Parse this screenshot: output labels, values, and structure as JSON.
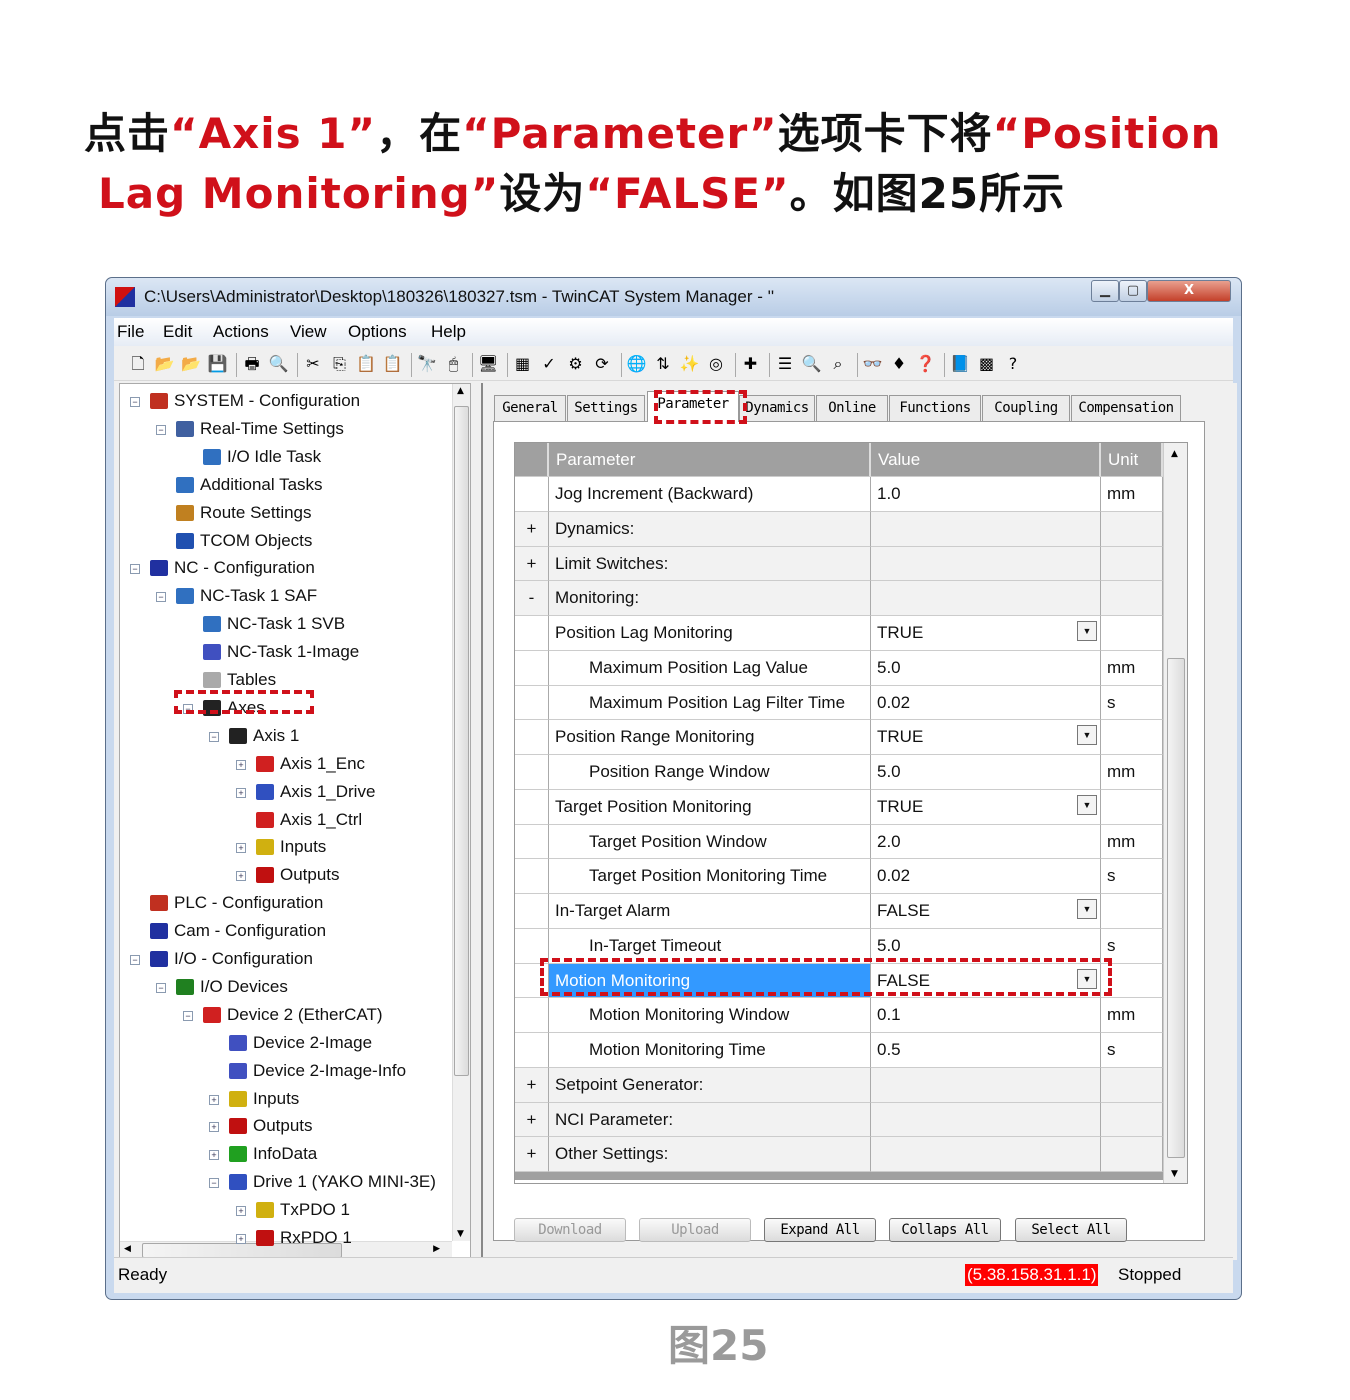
{
  "instruction": {
    "line1": [
      {
        "t": "点击",
        "q": false
      },
      {
        "t": "“Axis 1”",
        "q": true
      },
      {
        "t": "，在",
        "q": false
      },
      {
        "t": "“Parameter”",
        "q": true
      },
      {
        "t": "选项卡下将",
        "q": false
      },
      {
        "t": "“Position",
        "q": true
      }
    ],
    "line2": [
      {
        "t": "Lag Monitoring”",
        "q": true
      },
      {
        "t": "设为",
        "q": false
      },
      {
        "t": "“FALSE”",
        "q": true
      },
      {
        "t": "。如图25所示",
        "q": false
      }
    ]
  },
  "window": {
    "title": "C:\\Users\\Administrator\\Desktop\\180326\\180327.tsm - TwinCAT System Manager - ''",
    "minimize": "▁",
    "maximize": "▢",
    "close": "X"
  },
  "menu": [
    "File",
    "Edit",
    "Actions",
    "View",
    "Options",
    "Help"
  ],
  "toolbar": [
    {
      "icon": "new-file-icon",
      "g": "🗋"
    },
    {
      "icon": "open-folder-icon",
      "g": "📂"
    },
    {
      "icon": "open-icon",
      "g": "📂"
    },
    {
      "icon": "save-icon",
      "g": "💾"
    },
    {
      "sep": true
    },
    {
      "icon": "print-icon",
      "g": "🖶"
    },
    {
      "icon": "print-preview-icon",
      "g": "🔍"
    },
    {
      "sep": true
    },
    {
      "icon": "cut-icon",
      "g": "✂"
    },
    {
      "icon": "copy-icon",
      "g": "⎘"
    },
    {
      "icon": "paste-icon",
      "g": "📋"
    },
    {
      "icon": "paste-with-links-icon",
      "g": "📋"
    },
    {
      "sep": true
    },
    {
      "icon": "find-icon",
      "g": "🔭"
    },
    {
      "icon": "mouse-icon",
      "g": "🖱"
    },
    {
      "sep": true
    },
    {
      "icon": "computer-icon",
      "g": "🖥"
    },
    {
      "sep": true
    },
    {
      "icon": "generate-mappings-icon",
      "g": "▦"
    },
    {
      "icon": "check-icon",
      "g": "✓"
    },
    {
      "icon": "activate-config-icon",
      "g": "⚙"
    },
    {
      "icon": "restart-run-icon",
      "g": "⟳"
    },
    {
      "sep": true
    },
    {
      "icon": "choose-target-icon",
      "g": "🌐"
    },
    {
      "icon": "scan-devices-icon",
      "g": "⇅"
    },
    {
      "icon": "wizard-icon",
      "g": "✨"
    },
    {
      "icon": "config-mode-icon",
      "g": "◎"
    },
    {
      "sep": true
    },
    {
      "icon": "add-icon",
      "g": "✚"
    },
    {
      "sep": true
    },
    {
      "icon": "list-icon",
      "g": "☰"
    },
    {
      "icon": "zoom-icon",
      "g": "🔍"
    },
    {
      "icon": "toggle-free-run-icon",
      "g": "⌕"
    },
    {
      "sep": true
    },
    {
      "icon": "watch-icon",
      "g": "👓"
    },
    {
      "icon": "online-icon",
      "g": "♦"
    },
    {
      "icon": "online-io-icon",
      "g": "❓"
    },
    {
      "sep": true
    },
    {
      "icon": "book-icon",
      "g": "📘"
    },
    {
      "icon": "settings-icon",
      "g": "▩"
    },
    {
      "icon": "help-icon",
      "g": "?"
    }
  ],
  "tree": [
    {
      "label": "SYSTEM - Configuration",
      "level": 0,
      "exp": "-",
      "color": "#c03020"
    },
    {
      "label": "Real-Time Settings",
      "level": 1,
      "exp": "-",
      "color": "#4060a0"
    },
    {
      "label": "I/O Idle Task",
      "level": 2,
      "color": "#3070c0"
    },
    {
      "label": "Additional Tasks",
      "level": 1,
      "color": "#3070c0"
    },
    {
      "label": "Route Settings",
      "level": 1,
      "color": "#c08020"
    },
    {
      "label": "TCOM Objects",
      "level": 1,
      "color": "#2050b0"
    },
    {
      "label": "NC - Configuration",
      "level": 0,
      "exp": "-",
      "color": "#2030a0"
    },
    {
      "label": "NC-Task 1 SAF",
      "level": 1,
      "exp": "-",
      "color": "#3070c0"
    },
    {
      "label": "NC-Task 1 SVB",
      "level": 2,
      "color": "#3070c0"
    },
    {
      "label": "NC-Task 1-Image",
      "level": 2,
      "color": "#4050c0"
    },
    {
      "label": "Tables",
      "level": 2,
      "color": "#aaaaaa"
    },
    {
      "label": "Axes",
      "level": 2,
      "exp": "-",
      "color": "#222222"
    },
    {
      "label": "Axis 1",
      "level": 3,
      "exp": "-",
      "color": "#222222"
    },
    {
      "label": "Axis 1_Enc",
      "level": 4,
      "exp": "+",
      "color": "#d02020"
    },
    {
      "label": "Axis 1_Drive",
      "level": 4,
      "exp": "+",
      "color": "#3050c0"
    },
    {
      "label": "Axis 1_Ctrl",
      "level": 4,
      "color": "#d02020"
    },
    {
      "label": "Inputs",
      "level": 4,
      "exp": "+",
      "color": "#d0b010"
    },
    {
      "label": "Outputs",
      "level": 4,
      "exp": "+",
      "color": "#c01010"
    },
    {
      "label": "PLC - Configuration",
      "level": 0,
      "color": "#c03020"
    },
    {
      "label": "Cam - Configuration",
      "level": 0,
      "color": "#2030a0"
    },
    {
      "label": "I/O - Configuration",
      "level": 0,
      "exp": "-",
      "color": "#2030a0"
    },
    {
      "label": "I/O Devices",
      "level": 1,
      "exp": "-",
      "color": "#208020"
    },
    {
      "label": "Device 2 (EtherCAT)",
      "level": 2,
      "exp": "-",
      "color": "#d02020"
    },
    {
      "label": "Device 2-Image",
      "level": 3,
      "color": "#4050c0"
    },
    {
      "label": "Device 2-Image-Info",
      "level": 3,
      "color": "#4050c0"
    },
    {
      "label": "Inputs",
      "level": 3,
      "exp": "+",
      "color": "#d0b010"
    },
    {
      "label": "Outputs",
      "level": 3,
      "exp": "+",
      "color": "#c01010"
    },
    {
      "label": "InfoData",
      "level": 3,
      "exp": "+",
      "color": "#20a020"
    },
    {
      "label": "Drive 1 (YAKO MINI-3E)",
      "level": 3,
      "exp": "-",
      "color": "#3050c0"
    },
    {
      "label": "TxPDO 1",
      "level": 4,
      "exp": "+",
      "color": "#d0b010"
    },
    {
      "label": "RxPDO 1",
      "level": 4,
      "exp": "+",
      "color": "#c01010"
    }
  ],
  "tabs": [
    "General",
    "Settings",
    "Parameter",
    "Dynamics",
    "Online",
    "Functions",
    "Coupling",
    "Compensation"
  ],
  "active_tab": "Parameter",
  "grid": {
    "headers": {
      "parameter": "Parameter",
      "value": "Value",
      "unit": "Unit"
    },
    "rows": [
      {
        "m": "",
        "p": "Jog Increment (Backward)",
        "v": "1.0",
        "u": "mm"
      },
      {
        "m": "+",
        "p": "Dynamics:",
        "group": true
      },
      {
        "m": "+",
        "p": "Limit Switches:",
        "group": true
      },
      {
        "m": "-",
        "p": "Monitoring:",
        "group": true
      },
      {
        "m": "",
        "p": "Position Lag Monitoring",
        "v": "TRUE",
        "dd": true
      },
      {
        "m": "",
        "p": "Maximum Position Lag Value",
        "v": "5.0",
        "u": "mm",
        "ind": true
      },
      {
        "m": "",
        "p": "Maximum Position Lag Filter Time",
        "v": "0.02",
        "u": "s",
        "ind": true
      },
      {
        "m": "",
        "p": "Position Range Monitoring",
        "v": "TRUE",
        "dd": true
      },
      {
        "m": "",
        "p": "Position Range Window",
        "v": "5.0",
        "u": "mm",
        "ind": true
      },
      {
        "m": "",
        "p": "Target Position Monitoring",
        "v": "TRUE",
        "dd": true
      },
      {
        "m": "",
        "p": "Target Position Window",
        "v": "2.0",
        "u": "mm",
        "ind": true
      },
      {
        "m": "",
        "p": "Target Position Monitoring Time",
        "v": "0.02",
        "u": "s",
        "ind": true
      },
      {
        "m": "",
        "p": "In-Target Alarm",
        "v": "FALSE",
        "dd": true
      },
      {
        "m": "",
        "p": "In-Target Timeout",
        "v": "5.0",
        "u": "s",
        "ind": true
      },
      {
        "m": "",
        "p": "Motion Monitoring",
        "v": "FALSE",
        "dd": true,
        "selected": true
      },
      {
        "m": "",
        "p": "Motion Monitoring Window",
        "v": "0.1",
        "u": "mm",
        "ind": true
      },
      {
        "m": "",
        "p": "Motion Monitoring Time",
        "v": "0.5",
        "u": "s",
        "ind": true
      },
      {
        "m": "+",
        "p": "Setpoint Generator:",
        "group": true
      },
      {
        "m": "+",
        "p": "NCI Parameter:",
        "group": true
      },
      {
        "m": "+",
        "p": "Other Settings:",
        "group": true
      }
    ]
  },
  "buttons": [
    {
      "label": "Download",
      "enabled": false
    },
    {
      "label": "Upload",
      "enabled": false
    },
    {
      "label": "Expand All",
      "enabled": true
    },
    {
      "label": "Collaps All",
      "enabled": true
    },
    {
      "label": "Select All",
      "enabled": true
    }
  ],
  "status": {
    "text": "Ready",
    "address": "(5.38.158.31.1.1)",
    "state": "Stopped",
    "address_bg": "#ff0000"
  },
  "caption": "图25",
  "colors": {
    "accent": "#d0101a",
    "selection": "#3399ff"
  }
}
